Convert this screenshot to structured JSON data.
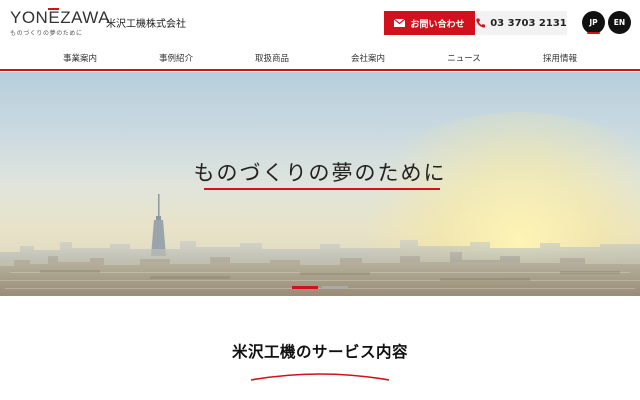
{
  "brand": {
    "logo_text": "YONEZAWA",
    "tagline": "ものづくりの夢のために",
    "company_name": "米沢工機株式会社",
    "accent_color": "#d3111c"
  },
  "header": {
    "contact_label": "お問い合わせ",
    "contact_icon": "mail-icon",
    "phone_number": "03 3703 2131",
    "phone_icon": "phone-icon",
    "languages": [
      "JP",
      "EN"
    ],
    "active_language": "JP"
  },
  "nav": {
    "items": [
      "事業案内",
      "事例紹介",
      "取扱商品",
      "会社案内",
      "ニュース",
      "採用情報"
    ]
  },
  "hero": {
    "title": "ものづくりの夢のために",
    "slide_count": 2,
    "active_slide": 1
  },
  "services": {
    "title": "米沢工機のサービス内容"
  }
}
